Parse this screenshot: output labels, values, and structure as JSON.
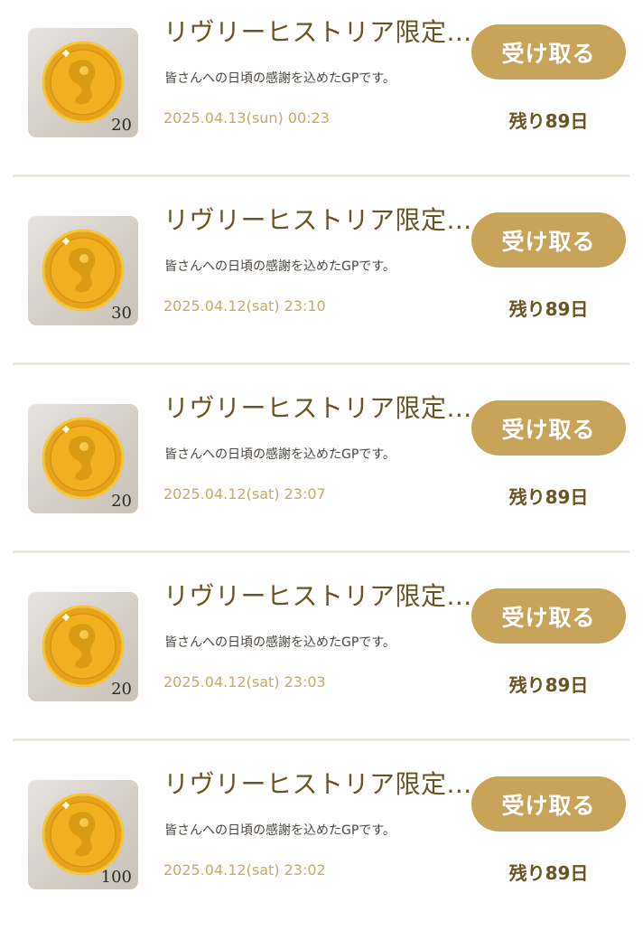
{
  "items": [
    {
      "title": "リヴリーヒストリア限定...",
      "description": "皆さんへの日頃の感謝を込めたGPです。",
      "date": "2025.04.13(sun) 00:23",
      "amount": "20",
      "button_label": "受け取る",
      "remaining": "残り89日",
      "icon": "gold-coin-icon"
    },
    {
      "title": "リヴリーヒストリア限定...",
      "description": "皆さんへの日頃の感謝を込めたGPです。",
      "date": "2025.04.12(sat) 23:10",
      "amount": "30",
      "button_label": "受け取る",
      "remaining": "残り89日",
      "icon": "gold-coin-icon"
    },
    {
      "title": "リヴリーヒストリア限定...",
      "description": "皆さんへの日頃の感謝を込めたGPです。",
      "date": "2025.04.12(sat) 23:07",
      "amount": "20",
      "button_label": "受け取る",
      "remaining": "残り89日",
      "icon": "gold-coin-icon"
    },
    {
      "title": "リヴリーヒストリア限定...",
      "description": "皆さんへの日頃の感謝を込めたGPです。",
      "date": "2025.04.12(sat) 23:03",
      "amount": "20",
      "button_label": "受け取る",
      "remaining": "残り89日",
      "icon": "gold-coin-icon"
    },
    {
      "title": "リヴリーヒストリア限定...",
      "description": "皆さんへの日頃の感謝を込めたGPです。",
      "date": "2025.04.12(sat) 23:02",
      "amount": "100",
      "button_label": "受け取る",
      "remaining": "残り89日",
      "icon": "gold-coin-icon"
    }
  ],
  "colors": {
    "accent": "#c7a45a",
    "title_text": "#6b5424",
    "date_text": "#cba867",
    "divider": "#efe7d9"
  }
}
